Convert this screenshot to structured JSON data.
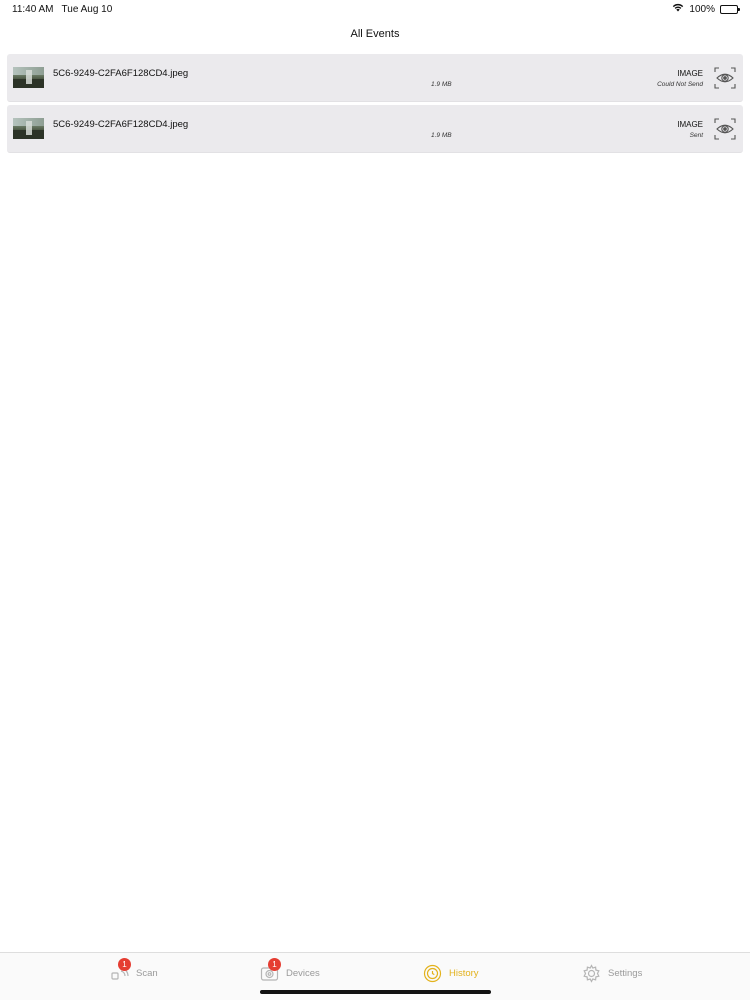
{
  "status_bar": {
    "time": "11:40 AM",
    "date": "Tue Aug 10",
    "battery_text": "100%",
    "icons": [
      "wifi-icon",
      "battery-icon"
    ]
  },
  "nav": {
    "title": "All Events"
  },
  "events": [
    {
      "filename": "5C6-9249-C2FA6F128CD4.jpeg",
      "size": "1.9 MB",
      "type": "IMAGE",
      "status": "Could Not Send",
      "icon": "eye-icon"
    },
    {
      "filename": "5C6-9249-C2FA6F128CD4.jpeg",
      "size": "1.9 MB",
      "type": "IMAGE",
      "status": "Sent",
      "icon": "eye-icon"
    }
  ],
  "tabs": [
    {
      "label": "Scan",
      "badge": "1",
      "icon": "scan-icon",
      "active": false
    },
    {
      "label": "Devices",
      "badge": "1",
      "icon": "devices-icon",
      "active": false
    },
    {
      "label": "History",
      "badge": "",
      "icon": "history-icon",
      "active": true
    },
    {
      "label": "Settings",
      "badge": "",
      "icon": "settings-icon",
      "active": false
    }
  ],
  "colors": {
    "accent": "#e3b21c",
    "inactive": "#9a9a9a",
    "badge": "#e53d32",
    "row_background": "#ebeaed"
  }
}
